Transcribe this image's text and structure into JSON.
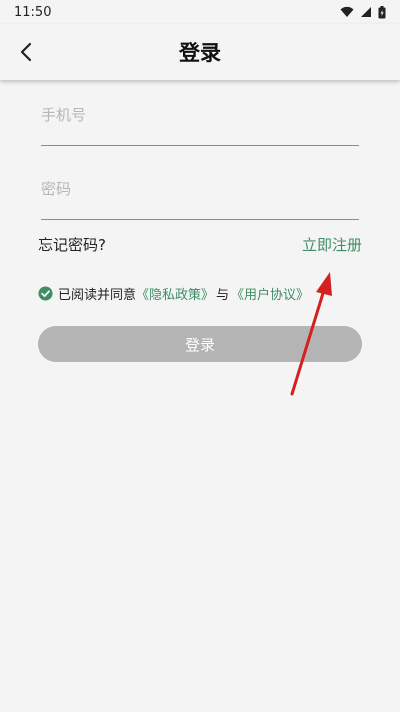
{
  "status_bar": {
    "time": "11:50"
  },
  "header": {
    "title": "登录",
    "back_icon": "chevron-left-icon"
  },
  "form": {
    "phone_placeholder": "手机号",
    "password_placeholder": "密码",
    "phone_value": "",
    "password_value": ""
  },
  "links": {
    "forgot_password": "忘记密码?",
    "register": "立即注册"
  },
  "agreement": {
    "prefix": "已阅读并同意",
    "privacy": "《隐私政策》",
    "conjunction": "与",
    "user_agreement": "《用户协议》",
    "checked": true
  },
  "login_button": "登录",
  "colors": {
    "accent": "#3e8d63",
    "button_disabled": "#b4b4b4",
    "annotation_arrow": "#d42020",
    "background": "#f4f4f4"
  }
}
